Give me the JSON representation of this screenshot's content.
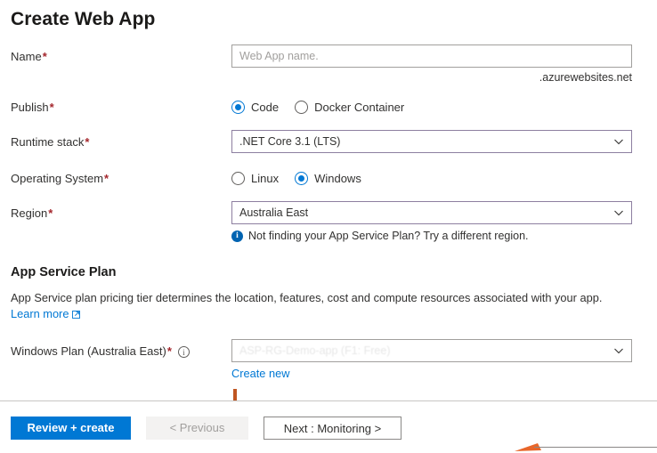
{
  "page": {
    "title": "Create Web App"
  },
  "form": {
    "name": {
      "label": "Name",
      "required_mark": "*",
      "placeholder": "Web App name.",
      "value": "",
      "suffix": ".azurewebsites.net"
    },
    "publish": {
      "label": "Publish",
      "required_mark": "*",
      "options": [
        {
          "label": "Code",
          "selected": true
        },
        {
          "label": "Docker Container",
          "selected": false
        }
      ]
    },
    "runtime_stack": {
      "label": "Runtime stack",
      "required_mark": "*",
      "value": ".NET Core 3.1 (LTS)"
    },
    "operating_system": {
      "label": "Operating System",
      "required_mark": "*",
      "options": [
        {
          "label": "Linux",
          "selected": false
        },
        {
          "label": "Windows",
          "selected": true
        }
      ]
    },
    "region": {
      "label": "Region",
      "required_mark": "*",
      "value": "Australia East",
      "note": "Not finding your App Service Plan? Try a different region.",
      "note_icon": "info-icon"
    }
  },
  "app_service_plan": {
    "heading": "App Service Plan",
    "description": "App Service plan pricing tier determines the location, features, cost and compute resources associated with your app.",
    "learn_more": "Learn more",
    "learn_more_icon": "external-link-icon",
    "windows_plan": {
      "label": "Windows Plan (Australia East)",
      "required_mark": "*",
      "info_icon": "info-outline-icon",
      "value": "ASP-RG-Demo-app (F1: Free)",
      "create_new": "Create new"
    }
  },
  "footer": {
    "review_create": "Review + create",
    "previous": "< Previous",
    "next": "Next : Monitoring >"
  },
  "icons": {
    "chevron_down": "chevron-down-icon"
  },
  "colors": {
    "accent_blue": "#0078d4",
    "required_red": "#a4262c",
    "info_blue": "#0063b1",
    "dropdown_border": "#8d7fa0",
    "input_border": "#a19f9d",
    "annotation_orange": "#e8662a"
  }
}
